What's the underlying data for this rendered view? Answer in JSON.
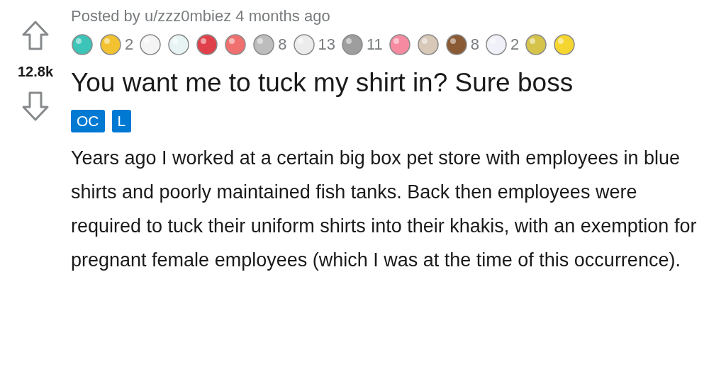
{
  "vote": {
    "score": "12.8k"
  },
  "post": {
    "meta": "Posted by u/zzz0mbiez 4 months ago",
    "awards": [
      {
        "color": "#3cc4b8"
      },
      {
        "color": "#f2c230",
        "count": "2"
      },
      {
        "color": "#f4f4f4"
      },
      {
        "color": "#e8f4f4"
      },
      {
        "color": "#e0404a"
      },
      {
        "color": "#f07070"
      },
      {
        "color": "#bdbdbd",
        "count": "8"
      },
      {
        "color": "#ececec",
        "count": "13"
      },
      {
        "color": "#9e9e9e",
        "count": "11"
      },
      {
        "color": "#f58aa0"
      },
      {
        "color": "#d8c8b8"
      },
      {
        "color": "#8a5a34",
        "count": "8"
      },
      {
        "color": "#f0f0f8",
        "count": "2"
      },
      {
        "color": "#d6c44a"
      },
      {
        "color": "#f5d630"
      }
    ],
    "title": "You want me to tuck my shirt in? Sure boss",
    "flairs": [
      "OC",
      "L"
    ],
    "body": "Years ago I worked at a certain big box pet store with employees in blue shirts and poorly maintained fish tanks. Back then employees were required to tuck their uniform shirts into their khakis, with an exemption for pregnant female employees (which I was at the time of this occurrence)."
  }
}
